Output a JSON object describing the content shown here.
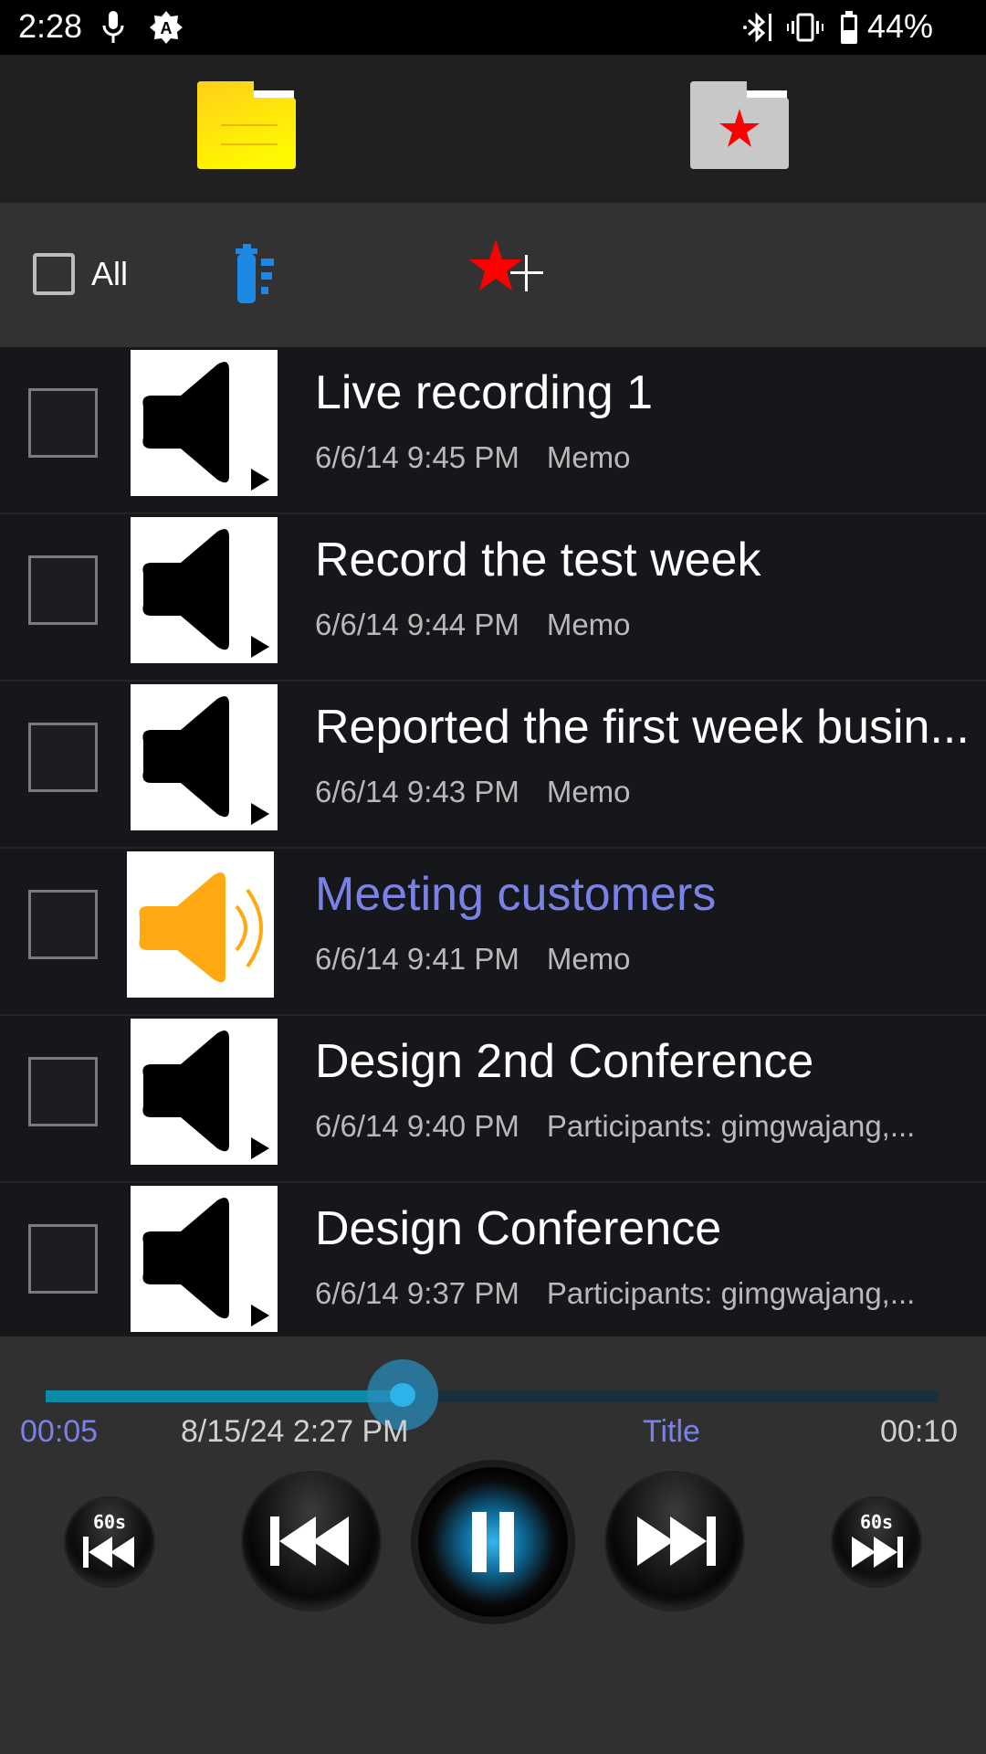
{
  "status_bar": {
    "time": "2:28",
    "battery_percent": "44%",
    "icons": [
      "microphone-icon",
      "auto-brightness-icon",
      "bluetooth-icon",
      "vibrate-icon",
      "battery-icon"
    ]
  },
  "tabs": [
    {
      "name": "all-recordings-tab",
      "icon": "folder-icon",
      "color": "#FFE600",
      "selected": true
    },
    {
      "name": "favorites-tab",
      "icon": "star-folder-icon",
      "color": "#C8C8C8",
      "selected": false
    }
  ],
  "toolbar": {
    "select_all_label": "All",
    "delete_icon": "trash-list-icon",
    "add_favorite_icon": "star-plus-icon"
  },
  "recordings": [
    {
      "title": "Live recording 1",
      "date": "6/6/14 9:45 PM",
      "note": "Memo",
      "playing": false
    },
    {
      "title": "Record the test week",
      "date": "6/6/14 9:44 PM",
      "note": "Memo",
      "playing": false
    },
    {
      "title": "Reported the first week busin...",
      "date": "6/6/14 9:43 PM",
      "note": "Memo",
      "playing": false
    },
    {
      "title": "Meeting customers",
      "date": "6/6/14 9:41 PM",
      "note": "Memo",
      "playing": true
    },
    {
      "title": "Design 2nd Conference",
      "date": "6/6/14 9:40 PM",
      "note": "Participants: gimgwajang,...",
      "playing": false
    },
    {
      "title": "Design Conference",
      "date": "6/6/14 9:37 PM",
      "note": "Participants: gimgwajang,...",
      "playing": false
    }
  ],
  "player": {
    "elapsed": "00:05",
    "recorded_at": "8/15/24 2:27 PM",
    "title_label": "Title",
    "duration": "00:10",
    "progress_percent": 40,
    "skip_back_label": "60s",
    "skip_forward_label": "60s",
    "state": "playing",
    "accent_color": "#7A82E8"
  }
}
